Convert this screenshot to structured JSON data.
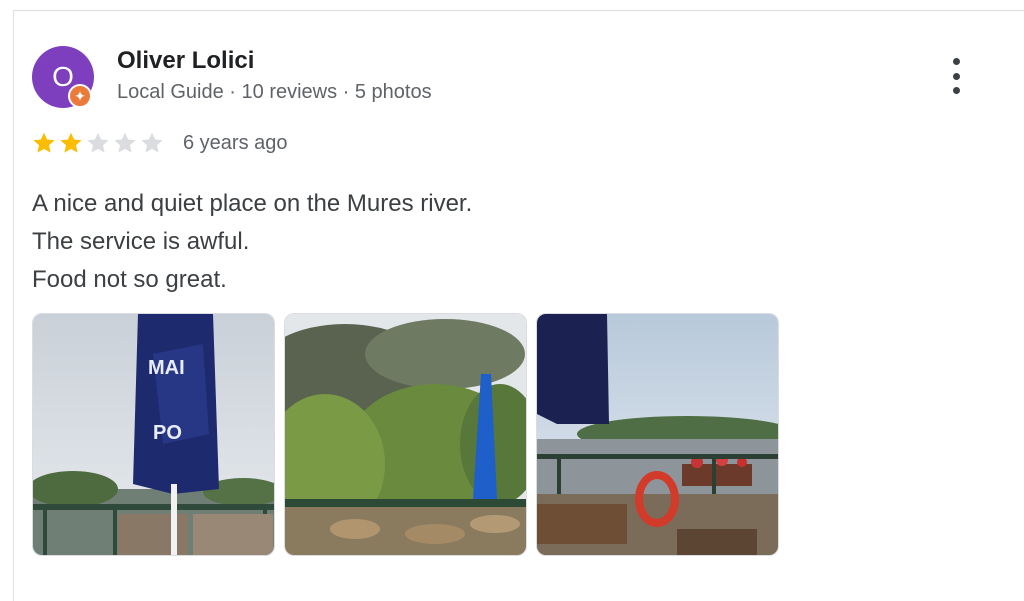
{
  "review": {
    "avatar_initial": "O",
    "reviewer_name": "Oliver Lolici",
    "reviewer_meta": "Local Guide · 10 reviews · 5 photos",
    "rating": 2,
    "max_rating": 5,
    "time_ago": "6 years ago",
    "text_lines": [
      "A nice and quiet place on the Mures river.",
      "The service is awful.",
      "Food not so great."
    ],
    "photos": [
      {
        "icon": "umbrella-terrace-photo"
      },
      {
        "icon": "trees-terrace-photo"
      },
      {
        "icon": "river-terrace-photo"
      }
    ]
  },
  "colors": {
    "avatar": "#7e3fbf",
    "badge": "#ea7b3b",
    "star_filled": "#fbbc04",
    "star_empty": "#dadce0"
  }
}
